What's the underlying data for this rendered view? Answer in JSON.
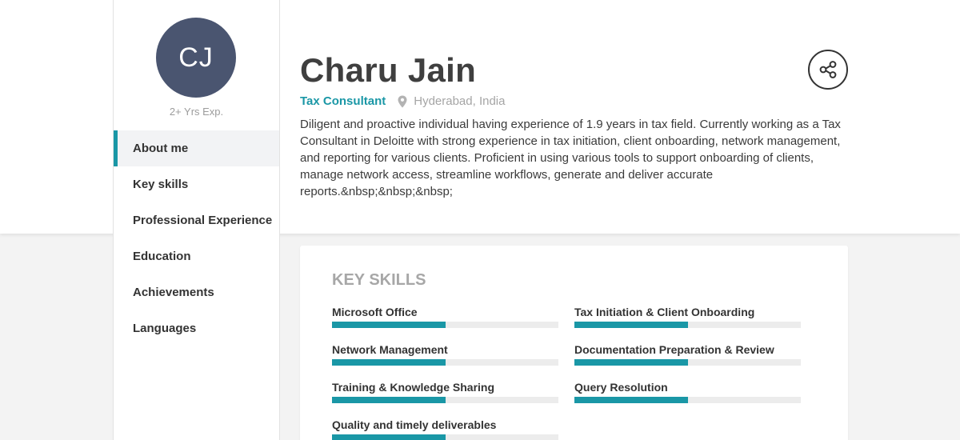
{
  "profile": {
    "initials": "CJ",
    "experience": "2+ Yrs Exp.",
    "name": "Charu Jain",
    "title": "Tax Consultant",
    "location": "Hyderabad, India",
    "about": "Diligent and proactive individual having experience of 1.9 years in tax field. Currently working as a Tax Consultant in Deloitte with strong experience in tax initiation, client onboarding, network management, and reporting for various clients. Proficient in using various tools to support onboarding of clients, manage network access, streamline workflows, generate and deliver accurate reports.&nbsp;&nbsp;&nbsp;"
  },
  "nav": {
    "items": [
      {
        "label": "About me",
        "active": true
      },
      {
        "label": "Key skills",
        "active": false
      },
      {
        "label": "Professional Experience",
        "active": false
      },
      {
        "label": "Education",
        "active": false
      },
      {
        "label": "Achievements",
        "active": false
      },
      {
        "label": "Languages",
        "active": false
      }
    ]
  },
  "skills": {
    "heading": "KEY SKILLS",
    "items": [
      {
        "name": "Microsoft Office",
        "level": 0.5
      },
      {
        "name": "Tax Initiation & Client Onboarding",
        "level": 0.5
      },
      {
        "name": "Network Management",
        "level": 0.5
      },
      {
        "name": "Documentation Preparation & Review",
        "level": 0.5
      },
      {
        "name": "Training & Knowledge Sharing",
        "level": 0.5
      },
      {
        "name": "Query Resolution",
        "level": 0.5
      },
      {
        "name": "Quality and timely deliverables",
        "level": 0.5
      }
    ]
  },
  "icons": {
    "share": "share-icon",
    "location": "location-pin-icon"
  },
  "colors": {
    "accent": "#1a97a6",
    "avatar_bg": "#4a5570"
  }
}
